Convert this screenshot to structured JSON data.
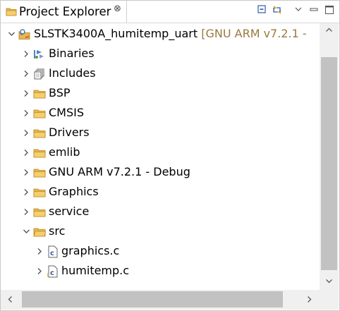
{
  "view": {
    "tab_title": "Project Explorer",
    "tab_close": "⊗"
  },
  "toolbar": {
    "collapse_all": "collapse-all",
    "link_editor": "link-with-editor",
    "view_menu": "view-menu",
    "minimize": "minimize",
    "maximize": "maximize"
  },
  "tree": {
    "project": {
      "name": "SLSTK3400A_humitemp_uart",
      "suffix": "[GNU ARM v7.2.1 -"
    },
    "items": [
      {
        "label": "Binaries"
      },
      {
        "label": "Includes"
      },
      {
        "label": "BSP"
      },
      {
        "label": "CMSIS"
      },
      {
        "label": "Drivers"
      },
      {
        "label": "emlib"
      },
      {
        "label": "GNU ARM v7.2.1 - Debug"
      },
      {
        "label": "Graphics"
      },
      {
        "label": "service"
      },
      {
        "label": "src"
      }
    ],
    "src_children": [
      {
        "label": "graphics.c"
      },
      {
        "label": "humitemp.c"
      }
    ]
  },
  "colors": {
    "folder": "#e8b64a",
    "decoration": "#9a7a3c",
    "scroll_thumb": "#c2c2c2"
  }
}
